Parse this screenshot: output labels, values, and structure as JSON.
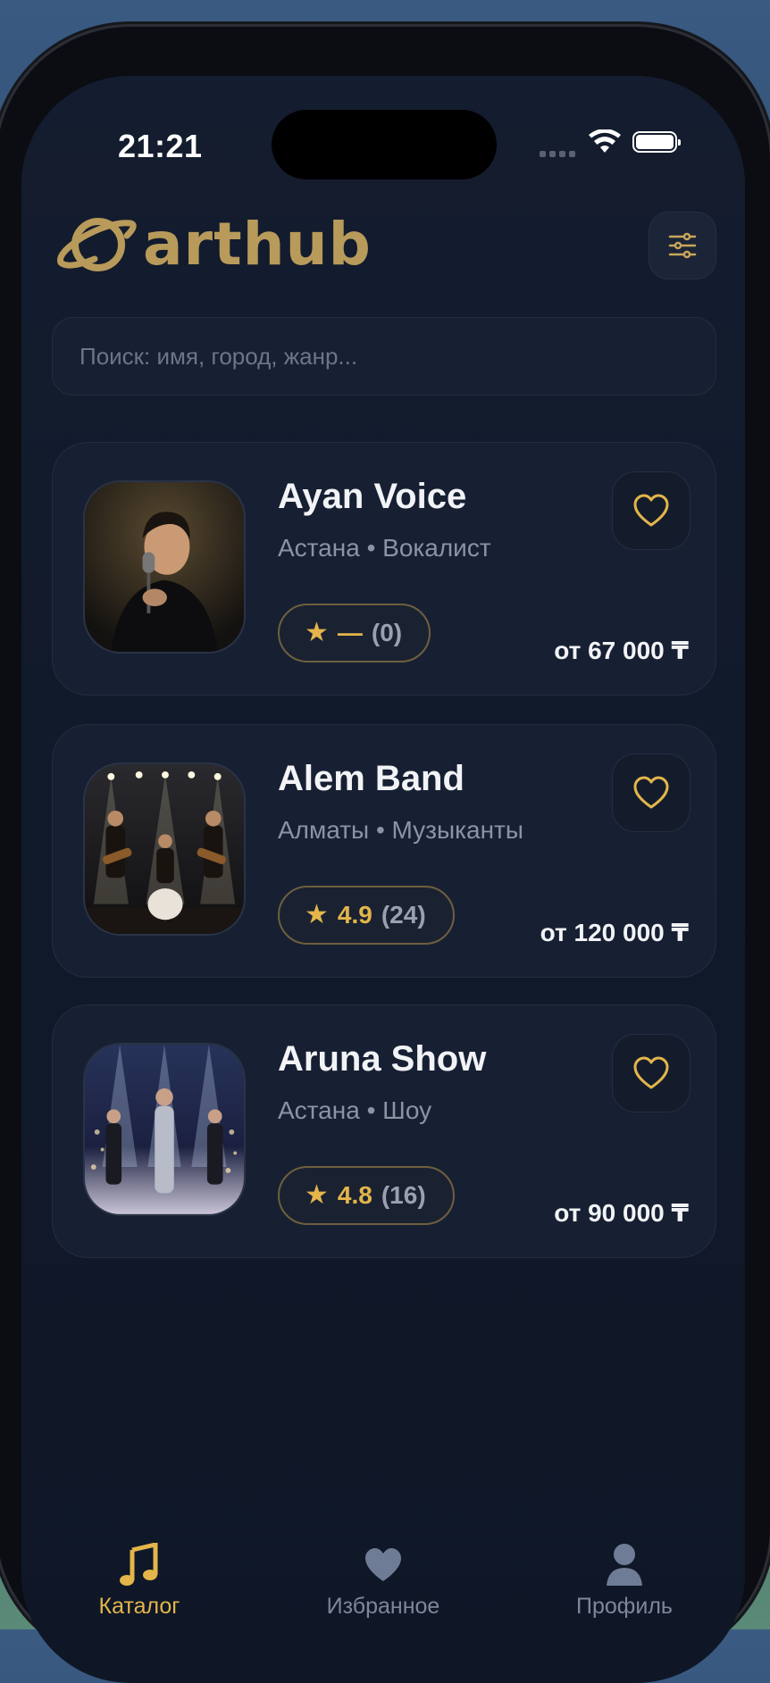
{
  "status_bar": {
    "time": "21:21"
  },
  "header": {
    "brand": "arthub",
    "filter_icon": "sliders-icon"
  },
  "search": {
    "placeholder": "Поиск: имя, город, жанр..."
  },
  "artists": [
    {
      "name": "Ayan Voice",
      "meta": "Астана • Вокалист",
      "rating": "—",
      "reviews": "(0)",
      "price": "от 67 000 ₸",
      "photo": "singer-with-microphone"
    },
    {
      "name": "Alem Band",
      "meta": "Алматы • Музыканты",
      "rating": "4.9",
      "reviews": "(24)",
      "price": "от 120 000 ₸",
      "photo": "band-on-stage"
    },
    {
      "name": "Aruna Show",
      "meta": "Астана • Шоу",
      "rating": "4.8",
      "reviews": "(16)",
      "price": "от 90 000 ₸",
      "photo": "show-performers-with-lights"
    }
  ],
  "tabs": [
    {
      "label": "Каталог",
      "icon": "music-note-icon",
      "active": true
    },
    {
      "label": "Избранное",
      "icon": "heart-icon",
      "active": false
    },
    {
      "label": "Профиль",
      "icon": "user-icon",
      "active": false
    }
  ],
  "colors": {
    "accent": "#e3b54a",
    "brand": "#b89a5a",
    "background": "#111a2b",
    "card": "#172033"
  }
}
